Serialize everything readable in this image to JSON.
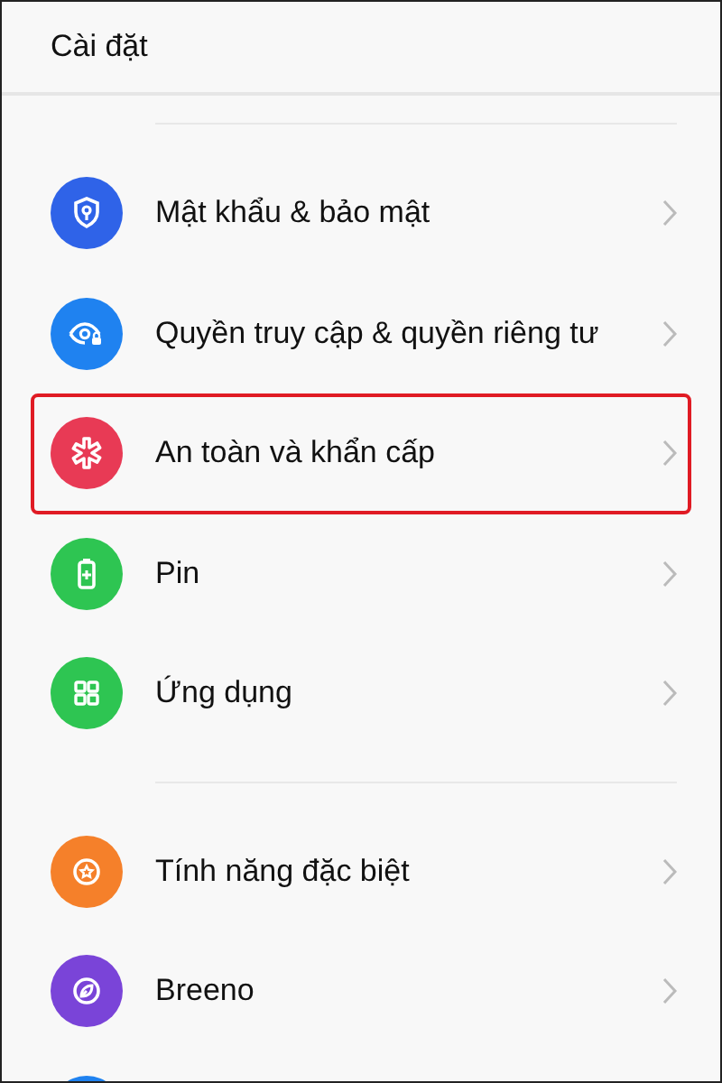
{
  "header": {
    "title": "Cài đặt"
  },
  "groups": [
    {
      "items": [
        {
          "label": "Mật khẩu & bảo mật",
          "color": "#2f63e8",
          "highlighted": false
        },
        {
          "label": "Quyền truy cập & quyền riêng tư",
          "color": "#1f82f0",
          "highlighted": false
        },
        {
          "label": "An toàn và khẩn cấp",
          "color": "#e83a55",
          "highlighted": true
        },
        {
          "label": "Pin",
          "color": "#2ec552",
          "highlighted": false
        },
        {
          "label": "Ứng dụng",
          "color": "#2ec552",
          "highlighted": false
        }
      ]
    },
    {
      "items": [
        {
          "label": "Tính năng đặc biệt",
          "color": "#f5802a",
          "highlighted": false
        },
        {
          "label": "Breeno",
          "color": "#7a44d8",
          "highlighted": false
        },
        {
          "color": "#1f82f0",
          "highlighted": false
        }
      ]
    }
  ]
}
